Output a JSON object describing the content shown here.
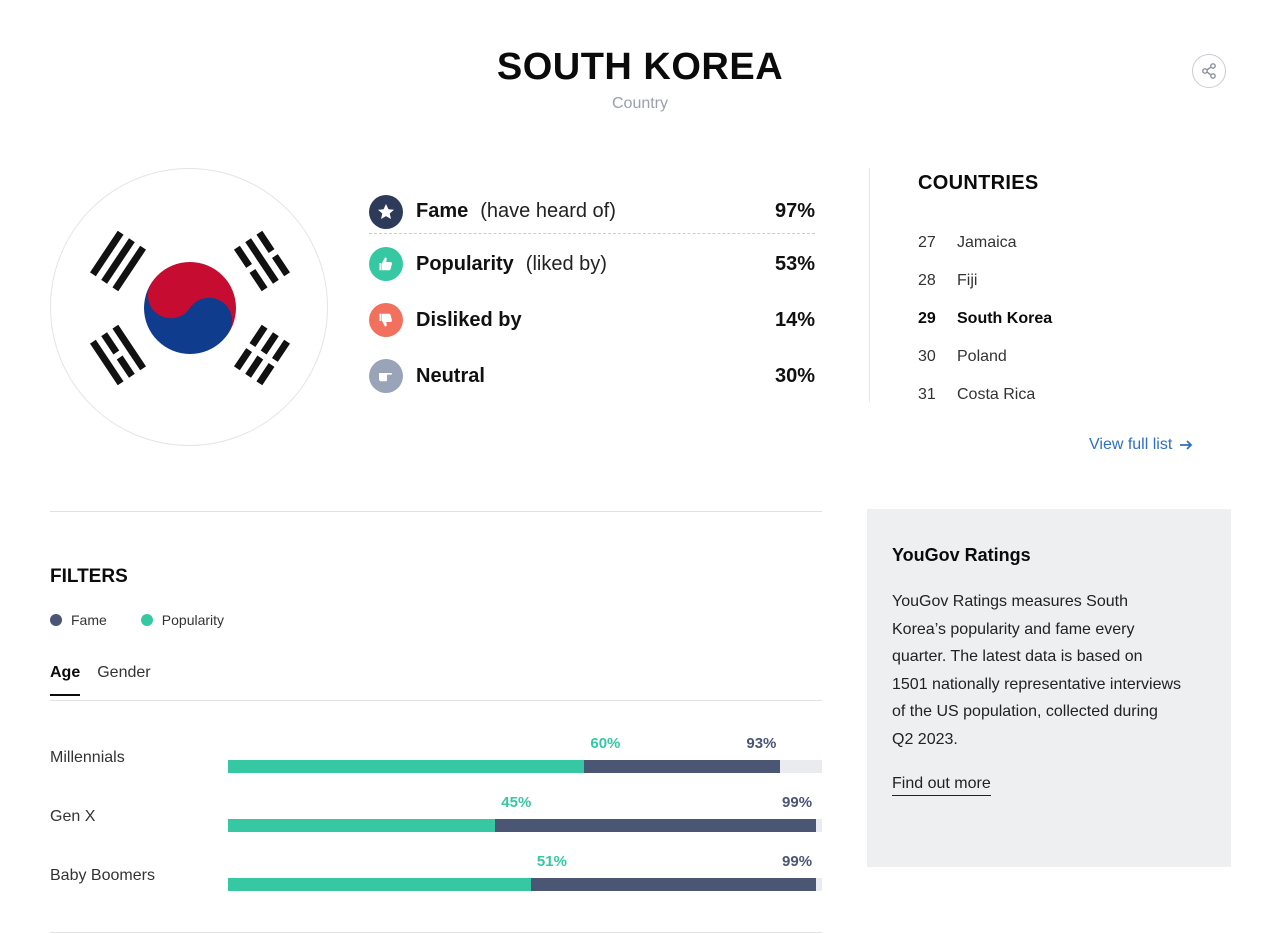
{
  "header": {
    "title": "SOUTH KOREA",
    "subtitle": "Country"
  },
  "stats": {
    "fame": {
      "label": "Fame",
      "sub": "(have heard of)",
      "value": "97%"
    },
    "popularity": {
      "label": "Popularity",
      "sub": "(liked by)",
      "value": "53%"
    },
    "disliked": {
      "label": "Disliked by",
      "value": "14%"
    },
    "neutral": {
      "label": "Neutral",
      "value": "30%"
    }
  },
  "countries": {
    "title": "COUNTRIES",
    "items": [
      {
        "rank": "27",
        "name": "Jamaica"
      },
      {
        "rank": "28",
        "name": "Fiji"
      },
      {
        "rank": "29",
        "name": "South Korea"
      },
      {
        "rank": "30",
        "name": "Poland"
      },
      {
        "rank": "31",
        "name": "Costa Rica"
      }
    ],
    "view_full": "View full list"
  },
  "filters": {
    "title": "FILTERS",
    "legend": {
      "fame": "Fame",
      "popularity": "Popularity"
    },
    "tabs": [
      "Age",
      "Gender"
    ],
    "active_tab": "Age"
  },
  "chart_data": {
    "type": "bar",
    "categories": [
      "Millennials",
      "Gen X",
      "Baby Boomers"
    ],
    "series": [
      {
        "name": "Popularity",
        "values": [
          60,
          45,
          51
        ]
      },
      {
        "name": "Fame",
        "values": [
          93,
          99,
          99
        ]
      }
    ],
    "ylim": [
      0,
      100
    ]
  },
  "info": {
    "title": "YouGov Ratings",
    "text": "YouGov Ratings measures South Korea’s popularity and fame every quarter. The latest data is based on 1501 nationally representative interviews of the US population, collected during Q2 2023.",
    "link": "Find out more"
  },
  "colors": {
    "fame": "#4a5673",
    "popularity": "#35c8a3",
    "disliked": "#f2705e",
    "neutral": "#9aa4b8",
    "link": "#2f6fc6"
  },
  "icons": {
    "share": "share-icon",
    "fame": "star-icon",
    "popularity": "thumbs-up-icon",
    "disliked": "thumbs-down-icon",
    "neutral": "hand-point-icon",
    "view_full": "arrow-right-icon"
  }
}
